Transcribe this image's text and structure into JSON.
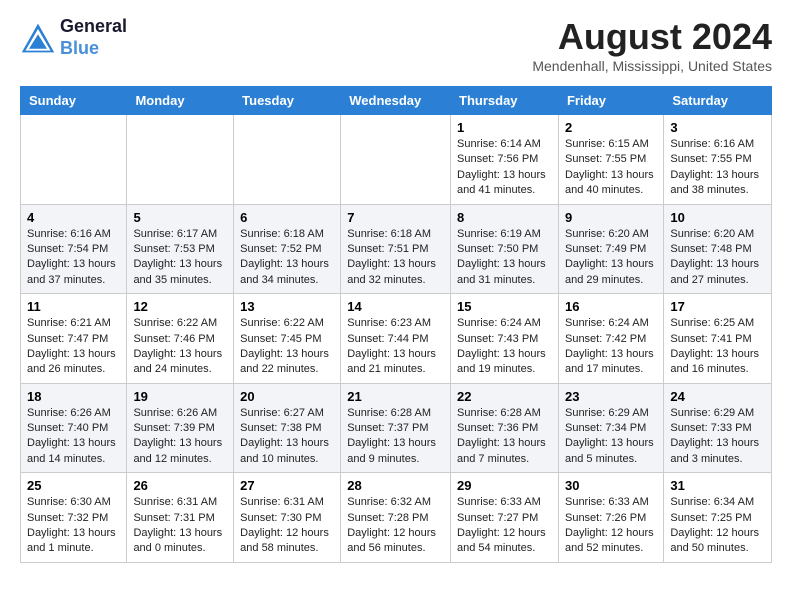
{
  "header": {
    "logo_line1": "General",
    "logo_line2": "Blue",
    "month_year": "August 2024",
    "location": "Mendenhall, Mississippi, United States"
  },
  "days_of_week": [
    "Sunday",
    "Monday",
    "Tuesday",
    "Wednesday",
    "Thursday",
    "Friday",
    "Saturday"
  ],
  "weeks": [
    [
      {
        "day": "",
        "sunrise": "",
        "sunset": "",
        "daylight": ""
      },
      {
        "day": "",
        "sunrise": "",
        "sunset": "",
        "daylight": ""
      },
      {
        "day": "",
        "sunrise": "",
        "sunset": "",
        "daylight": ""
      },
      {
        "day": "",
        "sunrise": "",
        "sunset": "",
        "daylight": ""
      },
      {
        "day": "1",
        "sunrise": "Sunrise: 6:14 AM",
        "sunset": "Sunset: 7:56 PM",
        "daylight": "Daylight: 13 hours and 41 minutes."
      },
      {
        "day": "2",
        "sunrise": "Sunrise: 6:15 AM",
        "sunset": "Sunset: 7:55 PM",
        "daylight": "Daylight: 13 hours and 40 minutes."
      },
      {
        "day": "3",
        "sunrise": "Sunrise: 6:16 AM",
        "sunset": "Sunset: 7:55 PM",
        "daylight": "Daylight: 13 hours and 38 minutes."
      }
    ],
    [
      {
        "day": "4",
        "sunrise": "Sunrise: 6:16 AM",
        "sunset": "Sunset: 7:54 PM",
        "daylight": "Daylight: 13 hours and 37 minutes."
      },
      {
        "day": "5",
        "sunrise": "Sunrise: 6:17 AM",
        "sunset": "Sunset: 7:53 PM",
        "daylight": "Daylight: 13 hours and 35 minutes."
      },
      {
        "day": "6",
        "sunrise": "Sunrise: 6:18 AM",
        "sunset": "Sunset: 7:52 PM",
        "daylight": "Daylight: 13 hours and 34 minutes."
      },
      {
        "day": "7",
        "sunrise": "Sunrise: 6:18 AM",
        "sunset": "Sunset: 7:51 PM",
        "daylight": "Daylight: 13 hours and 32 minutes."
      },
      {
        "day": "8",
        "sunrise": "Sunrise: 6:19 AM",
        "sunset": "Sunset: 7:50 PM",
        "daylight": "Daylight: 13 hours and 31 minutes."
      },
      {
        "day": "9",
        "sunrise": "Sunrise: 6:20 AM",
        "sunset": "Sunset: 7:49 PM",
        "daylight": "Daylight: 13 hours and 29 minutes."
      },
      {
        "day": "10",
        "sunrise": "Sunrise: 6:20 AM",
        "sunset": "Sunset: 7:48 PM",
        "daylight": "Daylight: 13 hours and 27 minutes."
      }
    ],
    [
      {
        "day": "11",
        "sunrise": "Sunrise: 6:21 AM",
        "sunset": "Sunset: 7:47 PM",
        "daylight": "Daylight: 13 hours and 26 minutes."
      },
      {
        "day": "12",
        "sunrise": "Sunrise: 6:22 AM",
        "sunset": "Sunset: 7:46 PM",
        "daylight": "Daylight: 13 hours and 24 minutes."
      },
      {
        "day": "13",
        "sunrise": "Sunrise: 6:22 AM",
        "sunset": "Sunset: 7:45 PM",
        "daylight": "Daylight: 13 hours and 22 minutes."
      },
      {
        "day": "14",
        "sunrise": "Sunrise: 6:23 AM",
        "sunset": "Sunset: 7:44 PM",
        "daylight": "Daylight: 13 hours and 21 minutes."
      },
      {
        "day": "15",
        "sunrise": "Sunrise: 6:24 AM",
        "sunset": "Sunset: 7:43 PM",
        "daylight": "Daylight: 13 hours and 19 minutes."
      },
      {
        "day": "16",
        "sunrise": "Sunrise: 6:24 AM",
        "sunset": "Sunset: 7:42 PM",
        "daylight": "Daylight: 13 hours and 17 minutes."
      },
      {
        "day": "17",
        "sunrise": "Sunrise: 6:25 AM",
        "sunset": "Sunset: 7:41 PM",
        "daylight": "Daylight: 13 hours and 16 minutes."
      }
    ],
    [
      {
        "day": "18",
        "sunrise": "Sunrise: 6:26 AM",
        "sunset": "Sunset: 7:40 PM",
        "daylight": "Daylight: 13 hours and 14 minutes."
      },
      {
        "day": "19",
        "sunrise": "Sunrise: 6:26 AM",
        "sunset": "Sunset: 7:39 PM",
        "daylight": "Daylight: 13 hours and 12 minutes."
      },
      {
        "day": "20",
        "sunrise": "Sunrise: 6:27 AM",
        "sunset": "Sunset: 7:38 PM",
        "daylight": "Daylight: 13 hours and 10 minutes."
      },
      {
        "day": "21",
        "sunrise": "Sunrise: 6:28 AM",
        "sunset": "Sunset: 7:37 PM",
        "daylight": "Daylight: 13 hours and 9 minutes."
      },
      {
        "day": "22",
        "sunrise": "Sunrise: 6:28 AM",
        "sunset": "Sunset: 7:36 PM",
        "daylight": "Daylight: 13 hours and 7 minutes."
      },
      {
        "day": "23",
        "sunrise": "Sunrise: 6:29 AM",
        "sunset": "Sunset: 7:34 PM",
        "daylight": "Daylight: 13 hours and 5 minutes."
      },
      {
        "day": "24",
        "sunrise": "Sunrise: 6:29 AM",
        "sunset": "Sunset: 7:33 PM",
        "daylight": "Daylight: 13 hours and 3 minutes."
      }
    ],
    [
      {
        "day": "25",
        "sunrise": "Sunrise: 6:30 AM",
        "sunset": "Sunset: 7:32 PM",
        "daylight": "Daylight: 13 hours and 1 minute."
      },
      {
        "day": "26",
        "sunrise": "Sunrise: 6:31 AM",
        "sunset": "Sunset: 7:31 PM",
        "daylight": "Daylight: 13 hours and 0 minutes."
      },
      {
        "day": "27",
        "sunrise": "Sunrise: 6:31 AM",
        "sunset": "Sunset: 7:30 PM",
        "daylight": "Daylight: 12 hours and 58 minutes."
      },
      {
        "day": "28",
        "sunrise": "Sunrise: 6:32 AM",
        "sunset": "Sunset: 7:28 PM",
        "daylight": "Daylight: 12 hours and 56 minutes."
      },
      {
        "day": "29",
        "sunrise": "Sunrise: 6:33 AM",
        "sunset": "Sunset: 7:27 PM",
        "daylight": "Daylight: 12 hours and 54 minutes."
      },
      {
        "day": "30",
        "sunrise": "Sunrise: 6:33 AM",
        "sunset": "Sunset: 7:26 PM",
        "daylight": "Daylight: 12 hours and 52 minutes."
      },
      {
        "day": "31",
        "sunrise": "Sunrise: 6:34 AM",
        "sunset": "Sunset: 7:25 PM",
        "daylight": "Daylight: 12 hours and 50 minutes."
      }
    ]
  ]
}
